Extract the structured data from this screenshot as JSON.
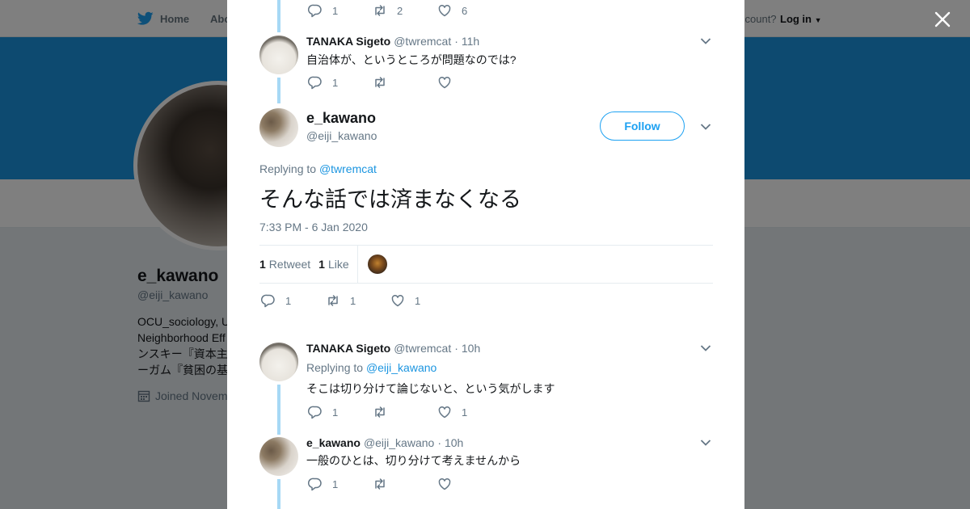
{
  "background": {
    "nav": {
      "home_label": "Home",
      "about_label": "Abo",
      "account_prompt": "ccount?",
      "login_label": "Log in"
    },
    "profile": {
      "name": "e_kawano",
      "handle": "@eiji_kawano",
      "bio_lines": [
        "OCU_sociology, U",
        "Neighborhood Eff",
        "ンスキー『資本主",
        "ーガム『貧困の基"
      ],
      "joined": "Joined Novem"
    }
  },
  "thread": {
    "top_actions": {
      "replies": "1",
      "retweets": "2",
      "likes": "6"
    },
    "tweet1": {
      "name": "TANAKA Sigeto",
      "handle": "@twremcat",
      "separator": "·",
      "time": "11h",
      "text": "自治体が、というところが問題なのでは?",
      "actions": {
        "replies": "1",
        "retweets": "",
        "likes": ""
      }
    },
    "main": {
      "name": "e_kawano",
      "handle": "@eiji_kawano",
      "follow_label": "Follow",
      "replying_prefix": "Replying to",
      "replying_to": "@twremcat",
      "text": "そんな話では済まなくなる",
      "timestamp": "7:33 PM - 6 Jan 2020",
      "retweets_count": "1",
      "retweets_label": "Retweet",
      "likes_count": "1",
      "likes_label": "Like",
      "actions": {
        "replies": "1",
        "retweets": "1",
        "likes": "1"
      }
    },
    "tweet3": {
      "name": "TANAKA Sigeto",
      "handle": "@twremcat",
      "separator": "·",
      "time": "10h",
      "replying_prefix": "Replying to",
      "replying_to": "@eiji_kawano",
      "text": "そこは切り分けて論じないと、という気がします",
      "actions": {
        "replies": "1",
        "retweets": "",
        "likes": "1"
      }
    },
    "tweet4": {
      "name": "e_kawano",
      "handle": "@eiji_kawano",
      "separator": "·",
      "time": "10h",
      "text": "一般のひとは、切り分けて考えませんから",
      "actions": {
        "replies": "1",
        "retweets": "",
        "likes": ""
      }
    }
  },
  "colors": {
    "accent": "#1da1f2",
    "thread_line": "#a6d8f5",
    "banner": "#1b95e0",
    "muted": "#657786"
  },
  "icons": [
    "twitter-bird-icon",
    "close-icon",
    "reply-icon",
    "retweet-icon",
    "like-icon",
    "chevron-down-icon",
    "calendar-icon"
  ]
}
